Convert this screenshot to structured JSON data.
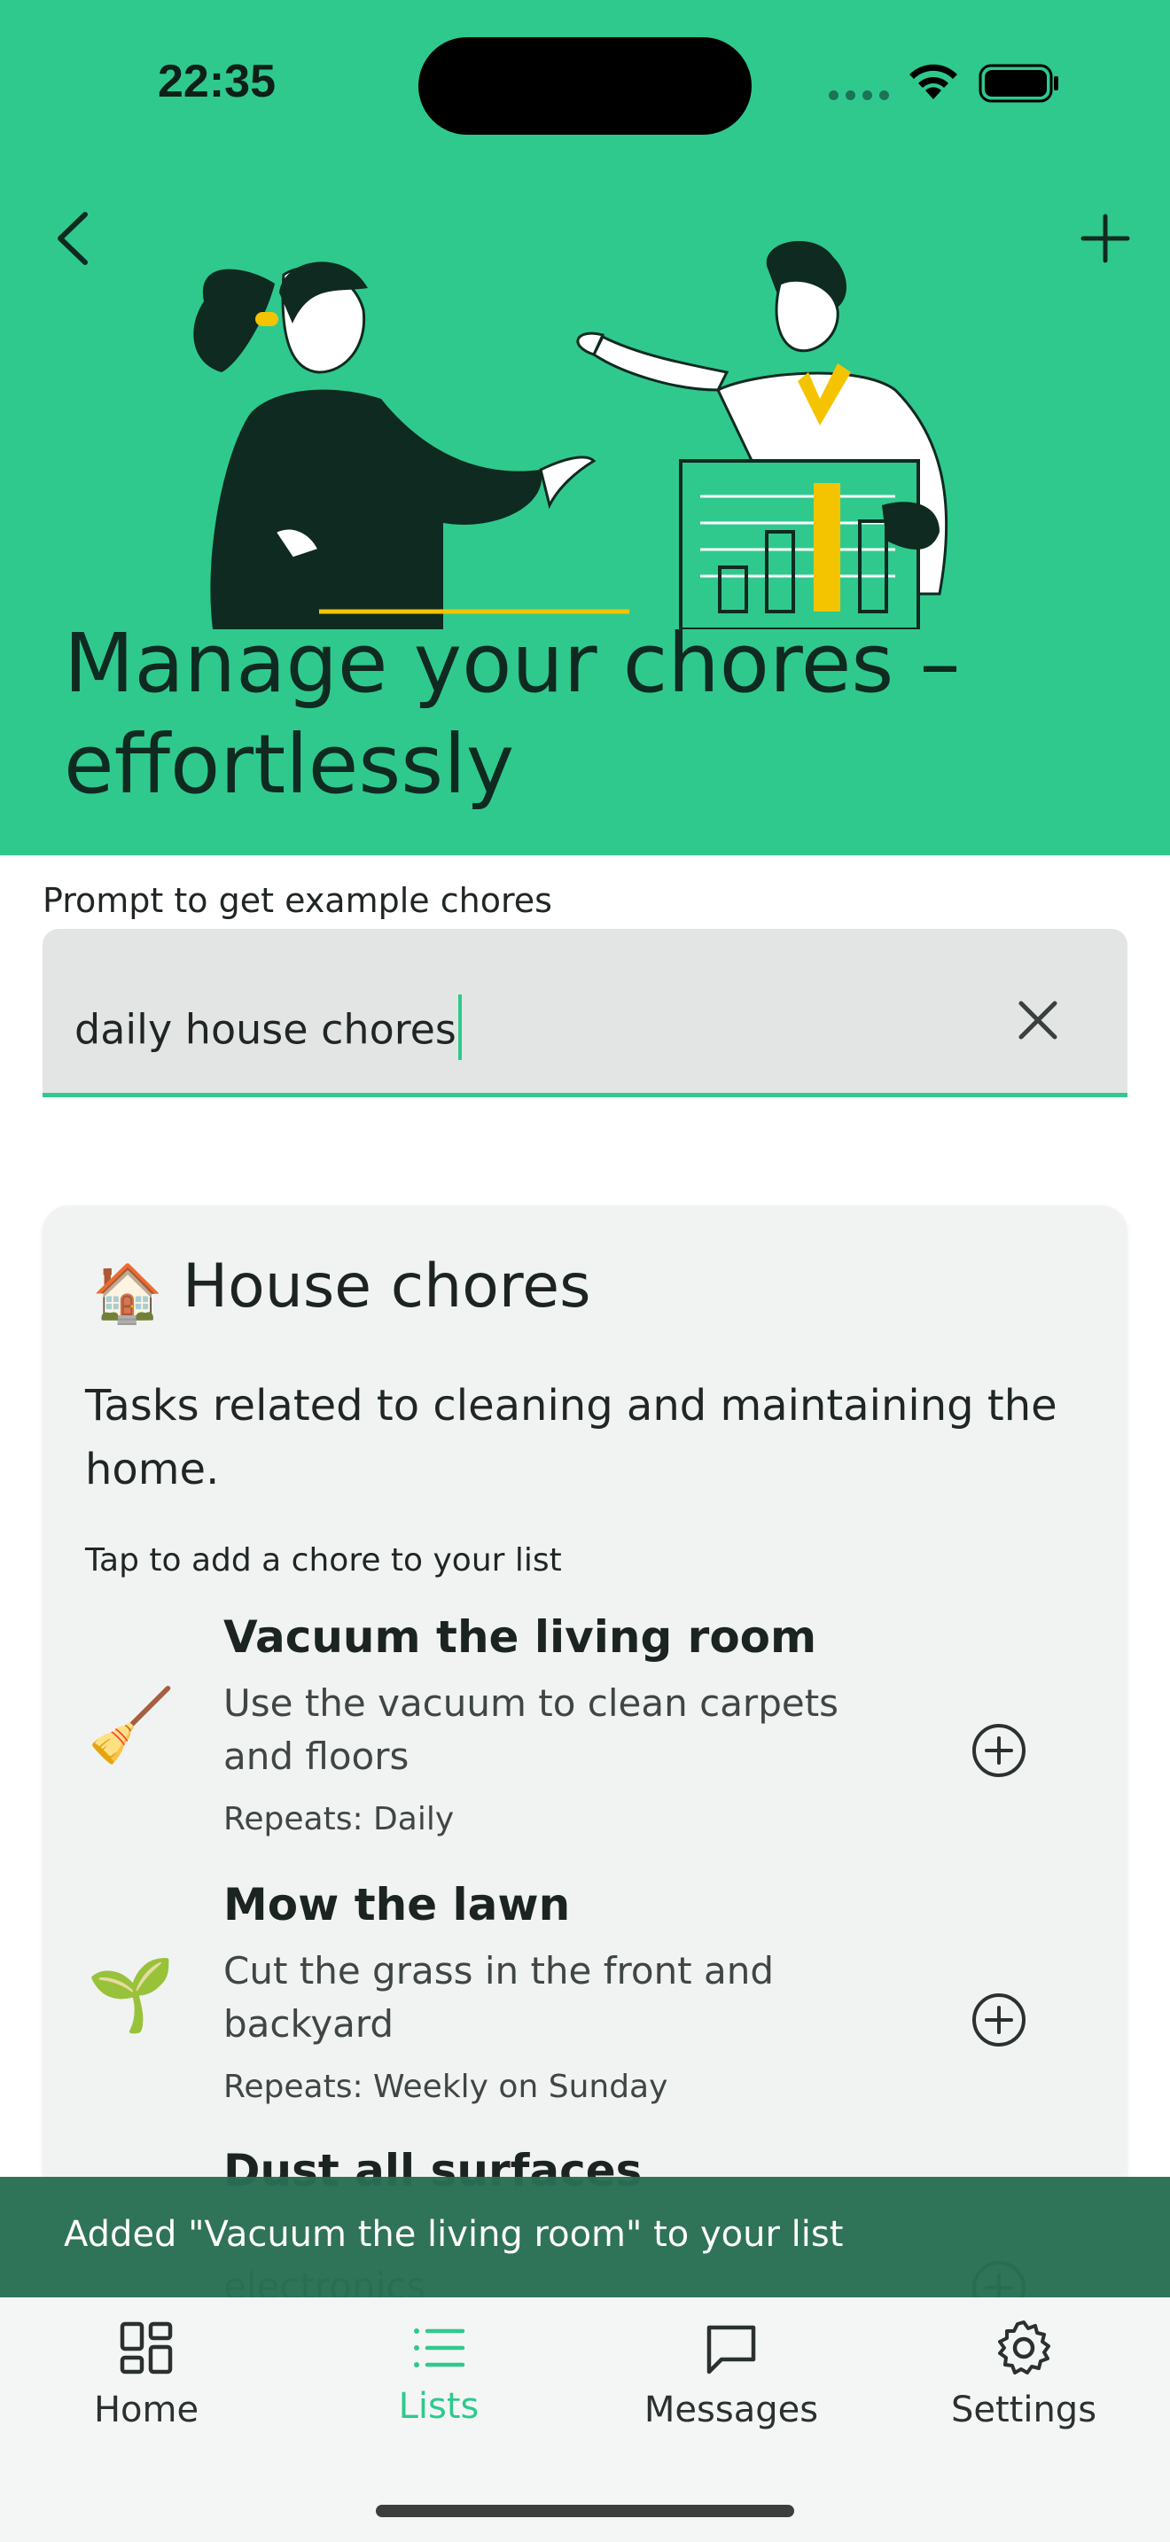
{
  "status_bar": {
    "time": "22:35",
    "icons": [
      "signal-dots-icon",
      "wifi-icon",
      "battery-icon"
    ]
  },
  "header": {
    "back_icon": "chevron-left-icon",
    "add_icon": "plus-icon",
    "title": "Manage your chores – effortlessly"
  },
  "prompt": {
    "label": "Prompt to get example chores",
    "value": "daily house chores",
    "clear_icon": "close-icon"
  },
  "card": {
    "emoji": "🏠",
    "title": "House chores",
    "description": "Tasks related to cleaning and maintaining the home.",
    "hint": "Tap to add a chore to your list",
    "chores": [
      {
        "emoji": "🧹",
        "title": "Vacuum the living room",
        "description": "Use the vacuum to clean carpets and floors",
        "repeat": "Repeats: Daily"
      },
      {
        "emoji": "🌱",
        "title": "Mow the lawn",
        "description": "Cut the grass in the front and backyard",
        "repeat": "Repeats: Weekly on Sunday"
      },
      {
        "emoji": "",
        "title": "Dust all surfaces",
        "description": "electronics",
        "repeat": ""
      }
    ]
  },
  "snackbar": {
    "text": "Added \"Vacuum the living room\" to your list"
  },
  "bottom_nav": {
    "items": [
      {
        "label": "Home",
        "icon": "grid-icon",
        "active": false
      },
      {
        "label": "Lists",
        "icon": "list-icon",
        "active": true
      },
      {
        "label": "Messages",
        "icon": "chat-bubble-icon",
        "active": false
      },
      {
        "label": "Settings",
        "icon": "gear-icon",
        "active": false
      }
    ]
  },
  "colors": {
    "accent": "#2fc98e",
    "snackbar": "#286e54",
    "dark_text": "#0f2a20"
  }
}
